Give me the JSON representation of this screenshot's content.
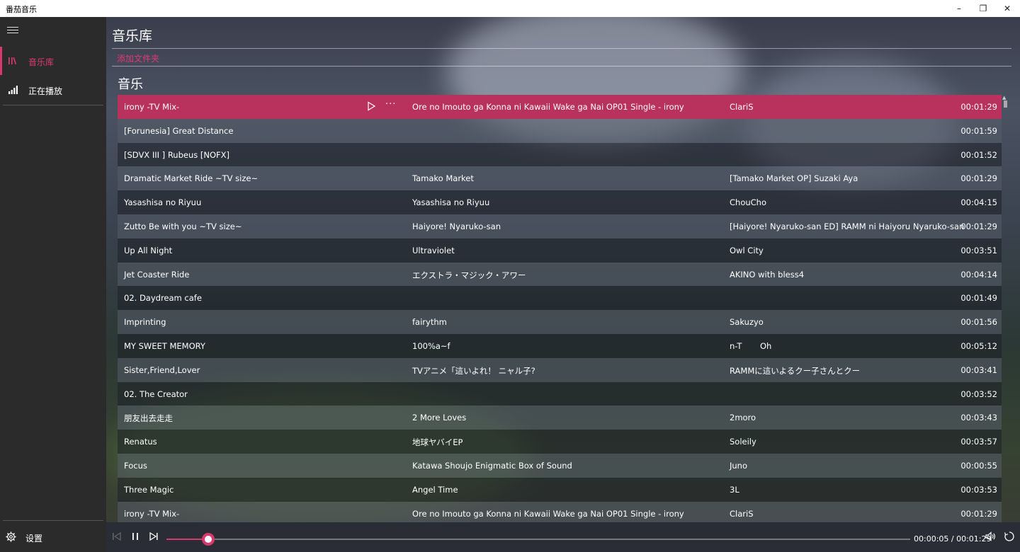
{
  "window": {
    "title": "番茄音乐",
    "minimize_glyph": "–",
    "restore_glyph": "❐",
    "close_glyph": "✕"
  },
  "sidebar": {
    "items": [
      {
        "label": "音乐库",
        "icon": "library-icon",
        "active": true
      },
      {
        "label": "正在播放",
        "icon": "now-playing-bars-icon",
        "active": false
      }
    ],
    "settings_label": "设置"
  },
  "page": {
    "title": "音乐库",
    "add_folder_label": "添加文件夹",
    "section_title": "音乐"
  },
  "songs": [
    {
      "title": "irony -TV Mix-",
      "album": "Ore no Imouto ga Konna ni Kawaii Wake ga Nai OP01 Single - irony",
      "artist": "ClariS",
      "duration": "00:01:29"
    },
    {
      "title": "[Forunesia] Great Distance",
      "album": "",
      "artist": "",
      "duration": "00:01:59"
    },
    {
      "title": "[SDVX III ] Rubeus [NOFX]",
      "album": "",
      "artist": "",
      "duration": "00:01:52"
    },
    {
      "title": "Dramatic Market Ride ~TV size~",
      "album": "Tamako Market",
      "artist": "[Tamako Market OP] Suzaki Aya",
      "duration": "00:01:29"
    },
    {
      "title": "Yasashisa no Riyuu",
      "album": "Yasashisa no Riyuu",
      "artist": "ChouCho",
      "duration": "00:04:15"
    },
    {
      "title": "Zutto Be with you ~TV size~",
      "album": "Haiyore! Nyaruko-san",
      "artist": "[Haiyore! Nyaruko-san ED] RAMM ni Haiyoru Nyaruko-san",
      "duration": "00:01:29"
    },
    {
      "title": "Up All Night",
      "album": "Ultraviolet",
      "artist": "Owl City",
      "duration": "00:03:51"
    },
    {
      "title": "Jet Coaster Ride",
      "album": "エクストラ・マジック・アワー",
      "artist": "AKINO with bless4",
      "duration": "00:04:14"
    },
    {
      "title": "02. Daydream cafe",
      "album": "",
      "artist": "",
      "duration": "00:01:49"
    },
    {
      "title": "Imprinting",
      "album": "fairythm",
      "artist": "Sakuzyo",
      "duration": "00:01:56"
    },
    {
      "title": "MY SWEET MEMORY",
      "album": "100%a~f",
      "artist": "n-T       Oh",
      "duration": "00:05:12"
    },
    {
      "title": "Sister,Friend,Lover",
      "album": "TVアニメ「這いよれ！ ニャル子?",
      "artist": "RAMMに這いよるクー子さんとクー",
      "duration": "00:03:41"
    },
    {
      "title": "02. The Creator",
      "album": "",
      "artist": "",
      "duration": "00:03:52"
    },
    {
      "title": "朋友出去走走",
      "album": "2 More Loves",
      "artist": "2moro",
      "duration": "00:03:43"
    },
    {
      "title": "Renatus",
      "album": "地球ヤバイEP",
      "artist": "Soleily",
      "duration": "00:03:57"
    },
    {
      "title": "Focus",
      "album": "Katawa Shoujo Enigmatic Box of Sound",
      "artist": "Juno",
      "duration": "00:00:55"
    },
    {
      "title": "Three Magic",
      "album": "Angel Time",
      "artist": "3L",
      "duration": "00:03:53"
    },
    {
      "title": "irony -TV Mix-",
      "album": "Ore no Imouto ga Konna ni Kawaii Wake ga Nai OP01 Single - irony",
      "artist": "ClariS",
      "duration": "00:01:29"
    }
  ],
  "selected_index": 0,
  "player": {
    "time_text": "00:00:05 / 00:01:29",
    "progress": 0.0562
  },
  "colors": {
    "accent": "#d6396b",
    "selected_row": "#b8325d"
  }
}
